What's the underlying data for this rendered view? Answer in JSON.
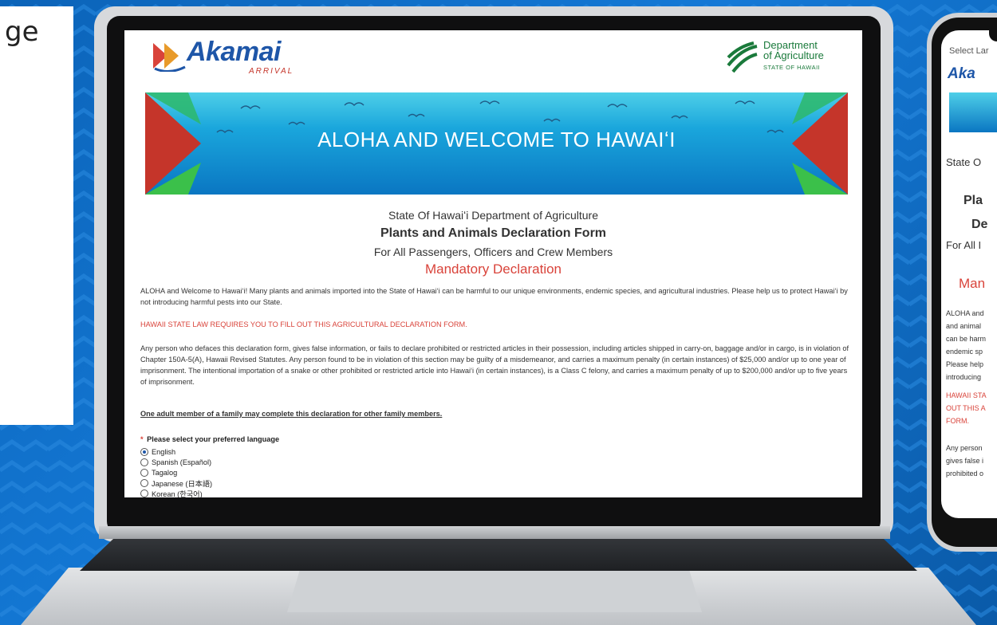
{
  "left_card": {
    "text": "ge"
  },
  "laptop": {
    "header": {
      "akamai_name": "Akamai",
      "akamai_sub": "ARRIVAL",
      "doa_line1": "Department",
      "doa_line2": "of Agriculture",
      "doa_sub": "STATE OF HAWAII"
    },
    "banner_title": "ALOHA AND WELCOME TO HAWAIʻI",
    "dept_line": "State Of Hawaiʻi Department of Agriculture",
    "form_title": "Plants and Animals Declaration Form",
    "for_line": "For All Passengers, Officers and Crew Members",
    "mandatory": "Mandatory Declaration",
    "p1": "ALOHA and Welcome to Hawaiʻi! Many plants and animals imported into the State of Hawaiʻi can be harmful to our unique environments, endemic species, and agricultural industries. Please help us to protect Hawaiʻi by not introducing harmful pests into our State.",
    "p2": "HAWAII STATE LAW REQUIRES YOU TO FILL OUT THIS AGRICULTURAL DECLARATION FORM.",
    "p3": "Any person who defaces this declaration form, gives false information, or fails to declare prohibited or restricted articles in their possession, including articles shipped in carry-on, baggage and/or in cargo, is in violation of Chapter 150A-5(A), Hawaii Revised Statutes. Any person found to be in violation of this section may be guilty of a misdemeanor, and carries a maximum penalty (in certain instances) of $25,000 and/or up to one year of imprisonment. The intentional importation of a snake or other prohibited or restricted article into Hawaiʻi (in certain instances), is a Class C felony, and carries a maximum penalty of up to $200,000 and/or up to five years of imprisonment.",
    "p4": "One adult member of a family may complete this declaration for other family members.",
    "language": {
      "required_mark": "*",
      "label": "Please select your preferred language",
      "options": [
        "English",
        "Spanish (Español)",
        "Tagalog",
        "Japanese (日本語)",
        "Korean (한국어)"
      ],
      "selected": "English"
    }
  },
  "phone": {
    "select": "Select Lar",
    "logo": "Aka",
    "state": "State O",
    "pla": "Pla",
    "de": "De",
    "forall": "For All I",
    "man": "Man",
    "body": "ALOHA and\nand animal\ncan be harm\nendemic sp\nPlease help\nintroducing",
    "law": "HAWAII STA\nOUT THIS A\nFORM.",
    "any": "Any person\ngives false i\nprohibited o"
  }
}
